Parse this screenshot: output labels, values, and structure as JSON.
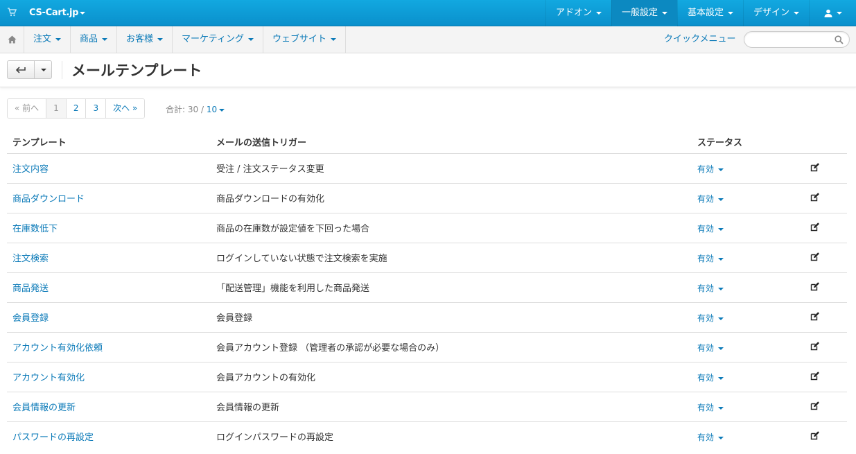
{
  "topbar": {
    "brand": "CS-Cart.jp",
    "nav": [
      "アドオン",
      "一般設定",
      "基本設定",
      "デザイン"
    ],
    "user_icon": "user-icon",
    "cart_icon": "cart-icon"
  },
  "subnav": {
    "home_icon": "home-icon",
    "items": [
      "注文",
      "商品",
      "お客様",
      "マーケティング",
      "ウェブサイト"
    ],
    "quick_menu": "クイックメニュー",
    "search_placeholder": ""
  },
  "page": {
    "title": "メールテンプレート",
    "back_icon": "back-arrow-icon"
  },
  "pagination": {
    "prev": "« 前へ",
    "pages": [
      "1",
      "2",
      "3"
    ],
    "current": "1",
    "next": "次へ »",
    "total_label": "合計: 30 /",
    "per_page": "10"
  },
  "table": {
    "headers": {
      "template": "テンプレート",
      "trigger": "メールの送信トリガー",
      "status": "ステータス"
    },
    "rows": [
      {
        "template": "注文内容",
        "trigger": "受注 / 注文ステータス変更",
        "status": "有効"
      },
      {
        "template": "商品ダウンロード",
        "trigger": "商品ダウンロードの有効化",
        "status": "有効"
      },
      {
        "template": "在庫数低下",
        "trigger": "商品の在庫数が設定値を下回った場合",
        "status": "有効"
      },
      {
        "template": "注文検索",
        "trigger": "ログインしていない状態で注文検索を実施",
        "status": "有効"
      },
      {
        "template": "商品発送",
        "trigger": "「配送管理」機能を利用した商品発送",
        "status": "有効"
      },
      {
        "template": "会員登録",
        "trigger": "会員登録",
        "status": "有効"
      },
      {
        "template": "アカウント有効化依頼",
        "trigger": "会員アカウント登録 （管理者の承認が必要な場合のみ）",
        "status": "有効"
      },
      {
        "template": "アカウント有効化",
        "trigger": "会員アカウントの有効化",
        "status": "有効"
      },
      {
        "template": "会員情報の更新",
        "trigger": "会員情報の更新",
        "status": "有効"
      },
      {
        "template": "パスワードの再設定",
        "trigger": "ログインパスワードの再設定",
        "status": "有効"
      }
    ]
  },
  "colors": {
    "accent": "#0b7ab8",
    "topbar": "#12a8e0"
  }
}
